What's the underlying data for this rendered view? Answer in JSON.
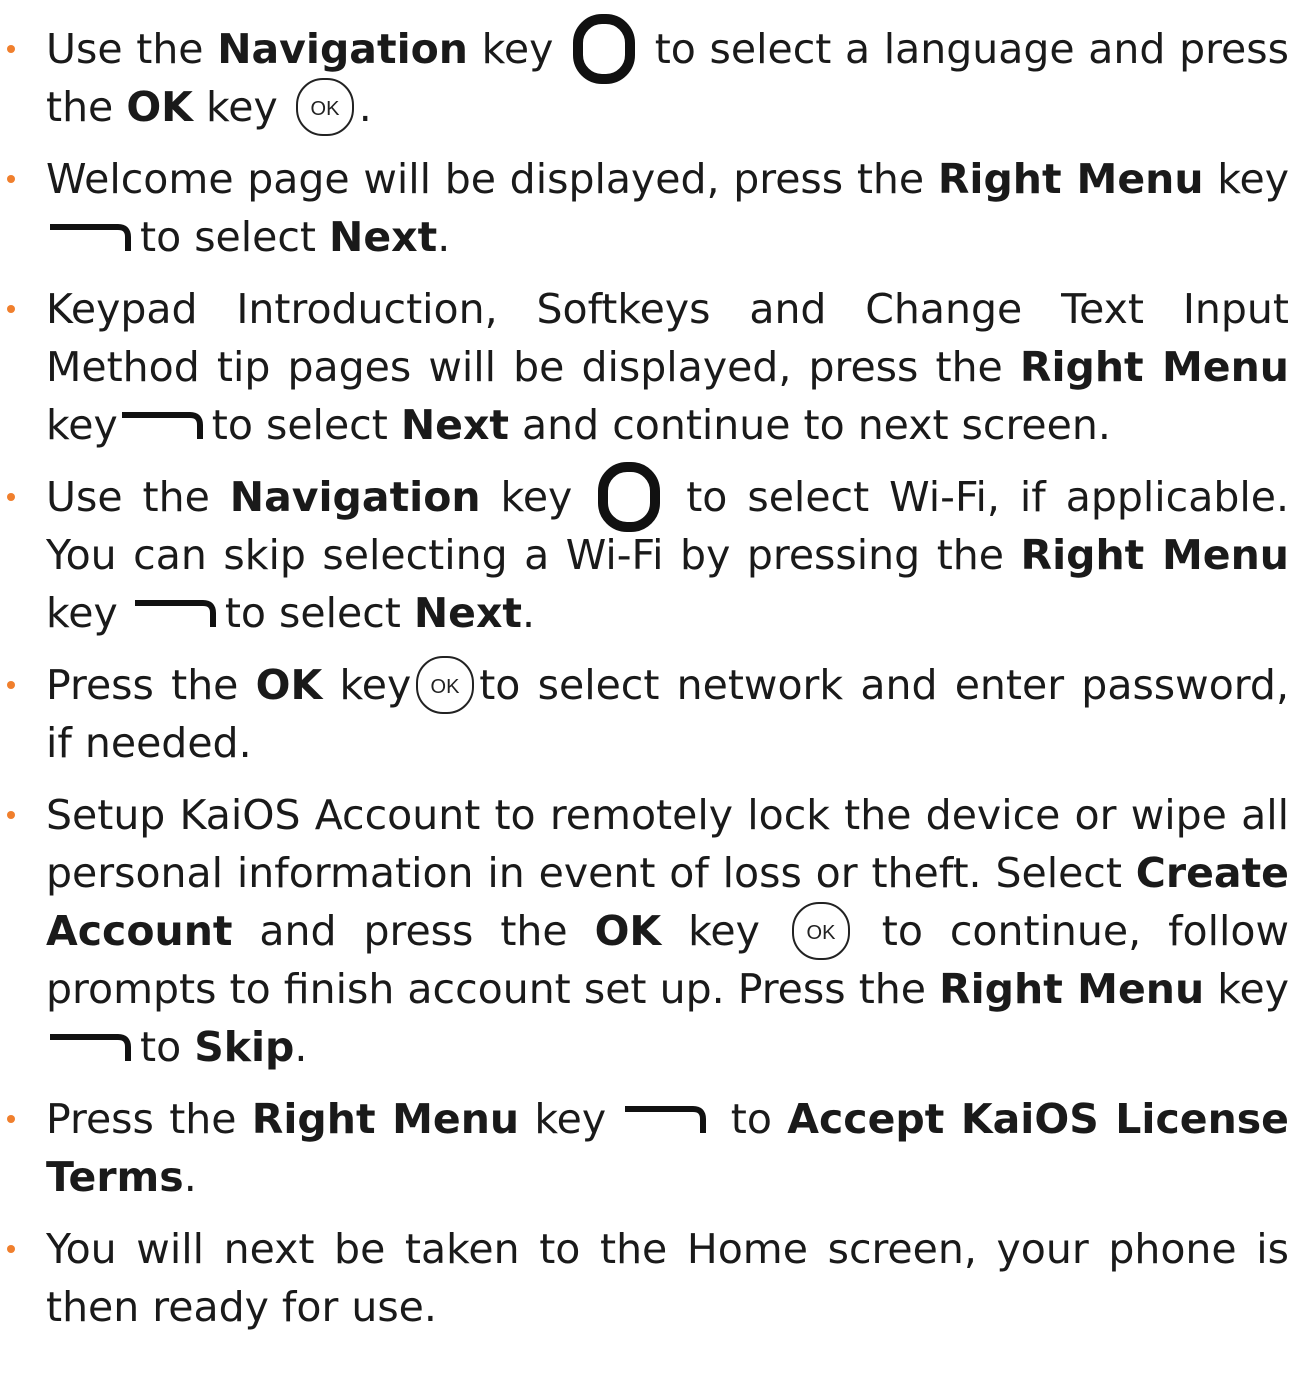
{
  "accent_color": "#f07f2d",
  "icons": {
    "navigation": "navigation-key-icon",
    "ok": "ok-key-icon",
    "right_menu": "right-menu-softkey-icon",
    "ok_label": "OK"
  },
  "steps": [
    {
      "t1": "Use the ",
      "b1": "Navigation",
      "t2": " key ",
      "t3": " to select a language and press the ",
      "b2": "OK",
      "t4": " key ",
      "t5": "."
    },
    {
      "t1": "Welcome page will be displayed, press the ",
      "b1": "Right Menu",
      "t2": " key ",
      "t3": "to select ",
      "b2": "Next",
      "t4": "."
    },
    {
      "t1": "Keypad Introduction, Softkeys and Change Text Input Method tip pages will be displayed, press the ",
      "b1": "Right Menu",
      "t2": " key",
      "t3": "to select ",
      "b2": "Next",
      "t4": " and continue to next screen."
    },
    {
      "t1": "Use the ",
      "b1": "Navigation",
      "t2": " key ",
      "t3": " to select Wi-Fi, if applicable. You can skip selecting a Wi-Fi by pressing the ",
      "b2": "Right Menu",
      "t4": " key ",
      "t5": "to select ",
      "b3": "Next",
      "t6": "."
    },
    {
      "t1": "Press the ",
      "b1": "OK",
      "t2": " key",
      "t3": "to select network and enter password, if needed."
    },
    {
      "t1": "Setup KaiOS Account to remotely lock the device or wipe all personal information in event of loss or theft. Select ",
      "b1": "Create Account",
      "t2": " and press the ",
      "b2": "OK",
      "t3": " key ",
      "t4": " to continue, follow prompts to finish account set up. Press the ",
      "b3": "Right Menu",
      "t5": "  key ",
      "t6": "to ",
      "b4": "Skip",
      "t7": "."
    },
    {
      "t1": "Press the ",
      "b1": "Right Menu",
      "t2": " key ",
      "t3": " to ",
      "b2": "Accept KaiOS License Terms",
      "t4": "."
    },
    {
      "t1": "You will next be taken to the Home screen, your phone is then ready for use."
    }
  ]
}
